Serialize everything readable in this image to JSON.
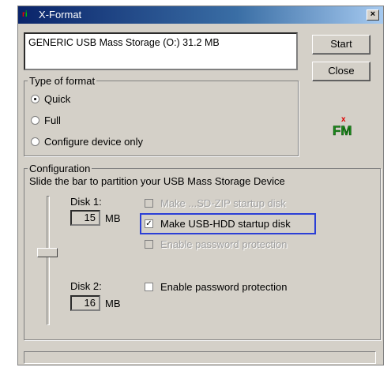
{
  "window": {
    "title": "X-Format",
    "close_glyph": "×"
  },
  "device": {
    "text": "GENERIC USB Mass Storage (O:) 31.2 MB"
  },
  "buttons": {
    "start": "Start",
    "close": "Close"
  },
  "type_of_format": {
    "label": "Type of format",
    "options": [
      {
        "label": "Quick",
        "selected": true
      },
      {
        "label": "Full",
        "selected": false
      },
      {
        "label": "Configure device only",
        "selected": false
      }
    ]
  },
  "configuration": {
    "label": "Configuration",
    "hint": "Slide the bar to partition your USB Mass Storage Device",
    "disk1": {
      "label": "Disk 1:",
      "value": "15",
      "unit": "MB"
    },
    "disk2": {
      "label": "Disk 2:",
      "value": "16",
      "unit": "MB"
    },
    "checks": [
      {
        "label": "Make ...SD-ZIP startup disk",
        "checked": false,
        "enabled": false
      },
      {
        "label": "Make USB-HDD startup disk",
        "checked": true,
        "enabled": true
      },
      {
        "label": "Enable password protection",
        "checked": false,
        "enabled": false
      },
      {
        "label": "Enable password protection",
        "checked": false,
        "enabled": true
      }
    ],
    "check_mark": "✓"
  },
  "logo": {
    "text": "FM"
  },
  "colors": {
    "titlebar": "#0a246a",
    "highlight": "#2b3fd6",
    "face": "#d4d0c8"
  }
}
